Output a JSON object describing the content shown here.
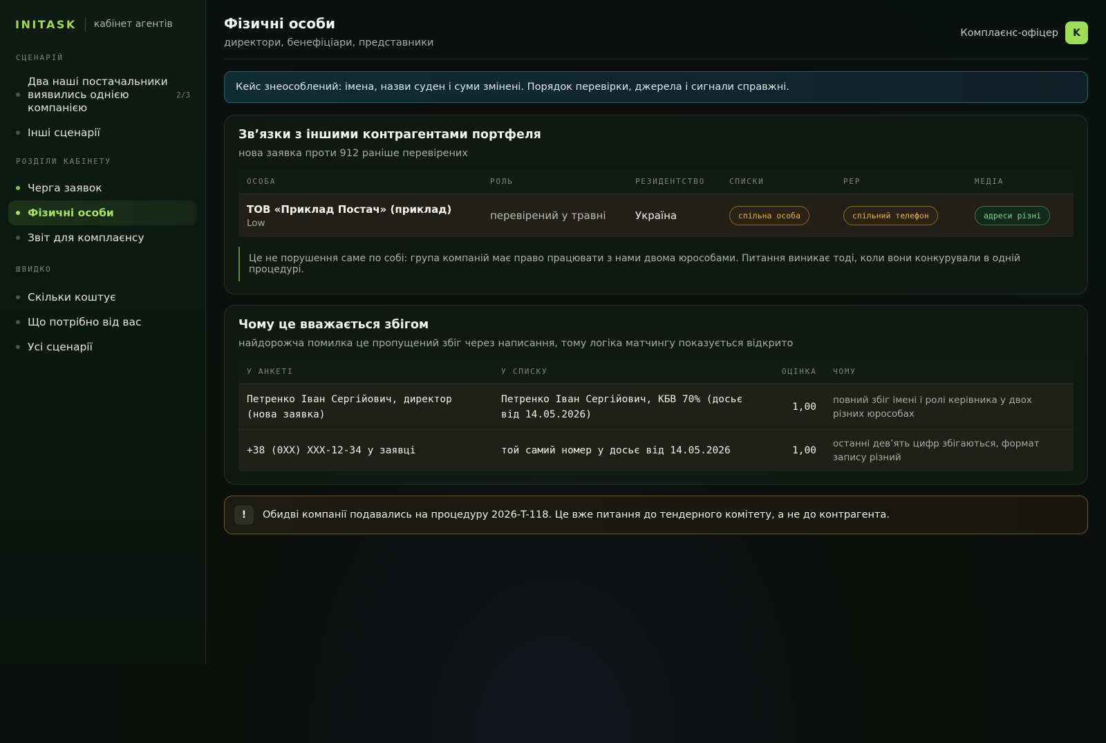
{
  "brand": {
    "logo": "INITASK",
    "subtitle": "кабінет агентів"
  },
  "sidebar": {
    "sections": [
      {
        "label": "СЦЕНАРІЙ"
      },
      {
        "label": "РОЗДІЛИ КАБІНЕТУ"
      },
      {
        "label": "ШВИДКО"
      }
    ],
    "scenario_items": [
      {
        "label": "Два наші постачальники виявились однією компанією",
        "counter": "2/3"
      },
      {
        "label": "Інші сценарії"
      }
    ],
    "cabinet_items": [
      {
        "label": "Черга заявок"
      },
      {
        "label": "Фізичні особи"
      },
      {
        "label": "Звіт для комплаєнсу"
      }
    ],
    "quick_items": [
      {
        "label": "Скільки коштує"
      },
      {
        "label": "Що потрібно від вас"
      },
      {
        "label": "Усі сценарії"
      }
    ]
  },
  "header": {
    "title": "Фізичні особи",
    "subtitle": "директори, бенефіціари, представники",
    "user_role": "Комплаєнс-офіцер",
    "avatar_initial": "K"
  },
  "info_banner": "Кейс знеособлений: імена, назви суден і суми змінені. Порядок перевірки, джерела і сигнали справжні.",
  "links_card": {
    "title": "Зв’язки з іншими контрагентами портфеля",
    "subtitle": "нова заявка проти 912 раніше перевірених",
    "columns": [
      "ОСОБА",
      "РОЛЬ",
      "РЕЗИДЕНТСТВО",
      "СПИСКИ",
      "PEP",
      "МЕДІА"
    ],
    "row": {
      "name": "ТОВ «Приклад Постач» (приклад)",
      "risk": "Low",
      "role": "перевірений у травні",
      "residency": "Україна",
      "lists": "спільна особа",
      "pep": "спільний телефон",
      "media": "адреси різні"
    },
    "note": "Це не порушення саме по собі: група компаній має право працювати з нами двома юрособами. Питання виникає тоді, коли вони конкурували в одній процедурі."
  },
  "match_card": {
    "title": "Чому це вважається збігом",
    "subtitle": "найдорожча помилка це пропущений збіг через написання, тому логіка матчингу показується відкрито",
    "columns": [
      "У АНКЕТІ",
      "У СПИСКУ",
      "ОЦІНКА",
      "ЧОМУ"
    ],
    "rows": [
      {
        "form": "Петренко Іван Сергійович, директор (нова заявка)",
        "list": "Петренко Іван Сергійович, КБВ 70% (досьє від 14.05.2026)",
        "score": "1,00",
        "why": "повний збіг імені і ролі керівника у двох різних юрособах"
      },
      {
        "form": "+38 (0XX) XXX-12-34 у заявці",
        "list": "той самий номер у досьє від 14.05.2026",
        "score": "1,00",
        "why": "останні дев’ять цифр збігаються, формат запису різний"
      }
    ]
  },
  "alert": {
    "icon": "!",
    "text": "Обидві компанії подавались на процедуру 2026-T-118. Це вже питання до тендерного комітету, а не до контрагента."
  }
}
